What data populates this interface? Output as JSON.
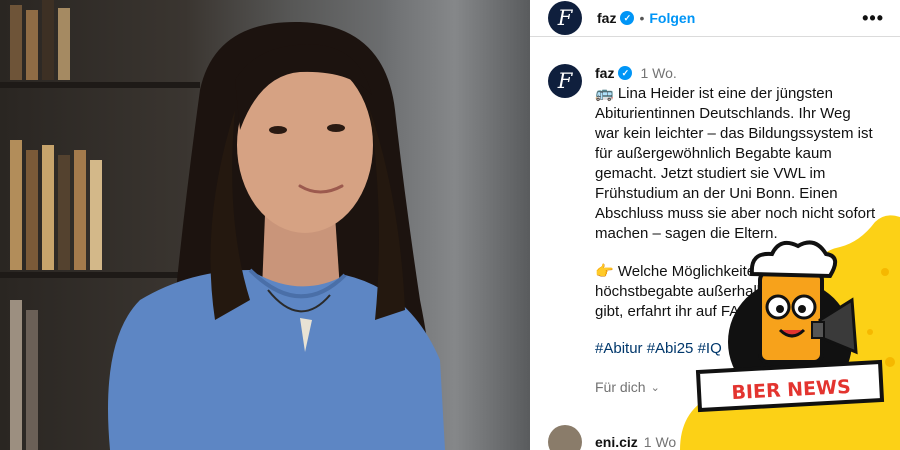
{
  "header": {
    "username": "faz",
    "separator": "•",
    "follow_label": "Folgen",
    "more_label": "•••",
    "logo_letter": "F"
  },
  "post": {
    "username": "faz",
    "age": "1 Wo.",
    "lines": [
      "🚌 Lina Heider ist eine der jüngsten",
      "Abiturientinnen Deutschlands. Ihr Weg",
      "war kein leichter – das Bildungssystem ist",
      "für außergewöhnlich Begabte kaum",
      "gemacht. Jetzt studiert sie VWL im",
      "Frühstudium an der Uni Bonn. Einen",
      "Abschluss muss sie aber noch nicht sofort",
      "machen – sagen die Eltern."
    ],
    "lines2": [
      "👉 Welche Möglichkeiten es für",
      "höchstbegabte außerhalb der Schule",
      "gibt, erfahrt ihr auf FAZ.NET."
    ],
    "hashtags": "#Abitur #Abi25 #IQ",
    "translate_label": "Für dich",
    "translate_chevron": "⌄"
  },
  "comment": {
    "username": "eni.ciz",
    "age": "1 Wo"
  },
  "sticker": {
    "label": "BIER NEWS"
  },
  "colors": {
    "accent": "#0095f6",
    "logo_bg": "#0f1f3d",
    "hashtag": "#00376b",
    "sticker_yellow": "#fcd116",
    "sticker_red": "#e3342f"
  }
}
